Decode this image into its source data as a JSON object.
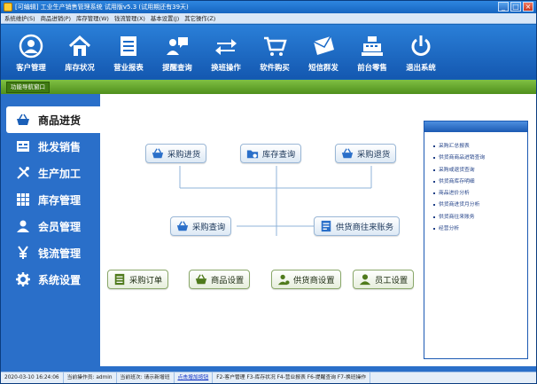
{
  "window": {
    "title": "[可编辑] 工业生产销售管理系统 试用版v5.3 (试用期还有39天)",
    "minimize": "_",
    "maximize": "□",
    "close": "×"
  },
  "menu": [
    "系统维护(S)",
    "商品进销(P)",
    "库存管理(W)",
    "钱流管理(X)",
    "基本设置(J)",
    "其它操作(Z)"
  ],
  "toolbar": [
    {
      "label": "客户管理",
      "icon": "user-circle-icon"
    },
    {
      "label": "库存状况",
      "icon": "home-icon"
    },
    {
      "label": "营业报表",
      "icon": "report-icon"
    },
    {
      "label": "提醒查询",
      "icon": "chat-bubble-icon"
    },
    {
      "label": "换班操作",
      "icon": "swap-arrows-icon"
    },
    {
      "label": "软件购买",
      "icon": "shopping-cart-icon"
    },
    {
      "label": "短信群发",
      "icon": "envelope-icon"
    },
    {
      "label": "前台零售",
      "icon": "cash-register-icon"
    },
    {
      "label": "退出系统",
      "icon": "power-icon"
    }
  ],
  "navstrip": {
    "tab": "功能导航窗口"
  },
  "sidebar": [
    {
      "label": "商品进货",
      "icon": "basket-icon",
      "active": true
    },
    {
      "label": "批发销售",
      "icon": "invoice-icon",
      "active": false
    },
    {
      "label": "生产加工",
      "icon": "tools-icon",
      "active": false
    },
    {
      "label": "库存管理",
      "icon": "grid-icon",
      "active": false
    },
    {
      "label": "会员管理",
      "icon": "person-icon",
      "active": false
    },
    {
      "label": "钱流管理",
      "icon": "yen-icon",
      "active": false
    },
    {
      "label": "系统设置",
      "icon": "gear-icon",
      "active": false
    }
  ],
  "flow": {
    "purchase_in": "采购进货",
    "stock_query": "库存查询",
    "purchase_return": "采购退货",
    "purchase_query": "采购查询",
    "supplier_account": "供货商往来账务",
    "purchase_order": "采购订单",
    "product_setup": "商品设置",
    "supplier_setup": "供货商设置",
    "staff_setup": "员工设置"
  },
  "reports": [
    "采购汇总报表",
    "供货商商品进销查询",
    "采购或退货查询",
    "供货商库存明细",
    "商品进价分析",
    "供货商进货月分析",
    "供货商往来账务",
    "经营分析"
  ],
  "statusbar": {
    "datetime": "2020-03-10 16:24:06",
    "operator": "当前操作员: admin",
    "shift": "当前班次: 请示新增班",
    "link": "点击增加按钮",
    "shortcuts": "F2-客户管理 F3-库存状况 F4-营业报表 F6-提醒查询 F7-换班操作"
  },
  "colors": {
    "title_blue": "#1565c0",
    "toolbar_blue": "#1a6ac8",
    "nav_green": "#5a9a22",
    "sidebar_blue": "#2a6fc9",
    "link_blue": "#0b2fc4"
  }
}
